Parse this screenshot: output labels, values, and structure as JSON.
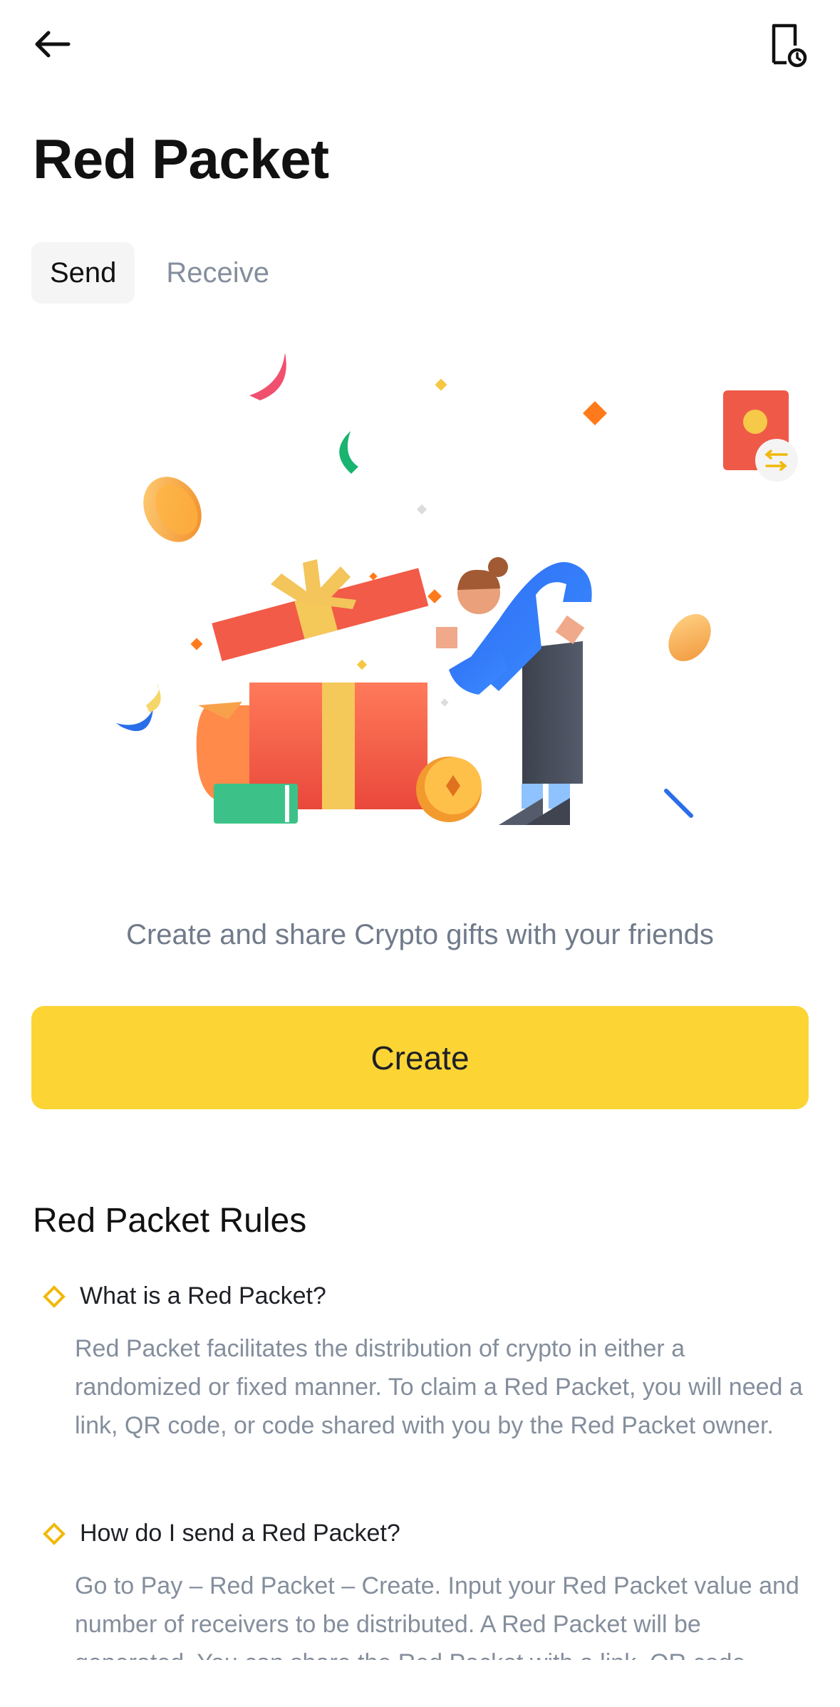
{
  "header": {
    "back_icon": "arrow-left-icon",
    "history_icon": "document-clock-icon"
  },
  "page": {
    "title": "Red Packet"
  },
  "tabs": [
    {
      "label": "Send",
      "active": true
    },
    {
      "label": "Receive",
      "active": false
    }
  ],
  "hero": {
    "subtitle": "Create and share Crypto gifts with your friends"
  },
  "actions": {
    "create_label": "Create"
  },
  "rules": {
    "title": "Red Packet Rules",
    "items": [
      {
        "question": "What is a Red Packet?",
        "answer": "Red Packet facilitates the distribution of crypto in either a randomized or fixed manner. To claim a Red Packet, you will need a link, QR code, or code shared with you by the Red Packet owner."
      },
      {
        "question": "How do I send a Red Packet?",
        "answer": "Go to Pay – Red Packet – Create. Input your Red Packet value and number of receivers to be distributed. A Red Packet will be generated. You can share the Red Packet with a link, QR code"
      }
    ]
  },
  "colors": {
    "accent": "#fcd535",
    "muted_text": "#848e9c",
    "diamond": "#f0b90b"
  }
}
